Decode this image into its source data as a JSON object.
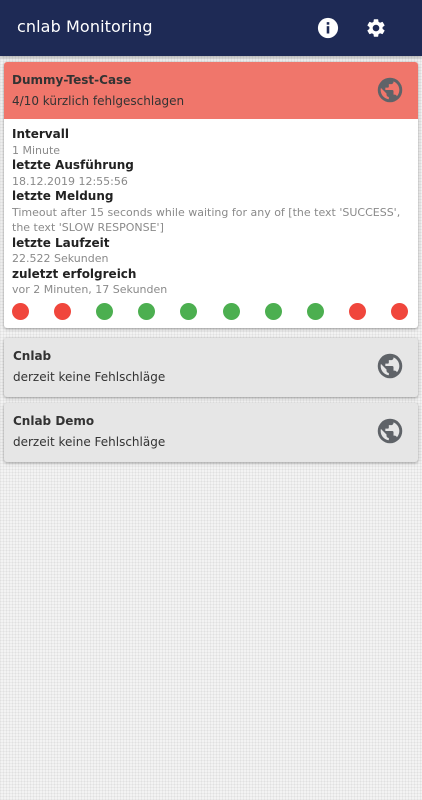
{
  "app": {
    "title": "cnlab Monitoring",
    "bar_color": "#1e2a55",
    "info_icon": "info-icon",
    "settings_icon": "gear-icon"
  },
  "cases": [
    {
      "name": "Dummy-Test-Case",
      "status": "4/10 kürzlich fehlgeschlagen",
      "header_color": "#f0766b",
      "icon": "globe-icon",
      "details": [
        {
          "label": "Intervall",
          "value": "1 Minute"
        },
        {
          "label": "letzte Ausführung",
          "value": "18.12.2019 12:55:56"
        },
        {
          "label": "letzte Meldung",
          "value": "Timeout after 15 seconds while waiting for any of [the text 'SUCCESS', the text 'SLOW RESPONSE']"
        },
        {
          "label": "letzte Laufzeit",
          "value": "22.522 Sekunden"
        },
        {
          "label": "zuletzt erfolgreich",
          "value": "vor 2 Minuten, 17 Sekunden"
        }
      ],
      "history": [
        "fail",
        "fail",
        "ok",
        "ok",
        "ok",
        "ok",
        "ok",
        "ok",
        "fail",
        "fail"
      ]
    },
    {
      "name": "Cnlab",
      "status": "derzeit keine Fehlschläge",
      "icon": "globe-icon"
    },
    {
      "name": "Cnlab Demo",
      "status": "derzeit keine Fehlschläge",
      "icon": "globe-icon"
    }
  ],
  "colors": {
    "fail": "#f0463c",
    "ok": "#4caf50",
    "icon_gray": "#5f6368"
  }
}
